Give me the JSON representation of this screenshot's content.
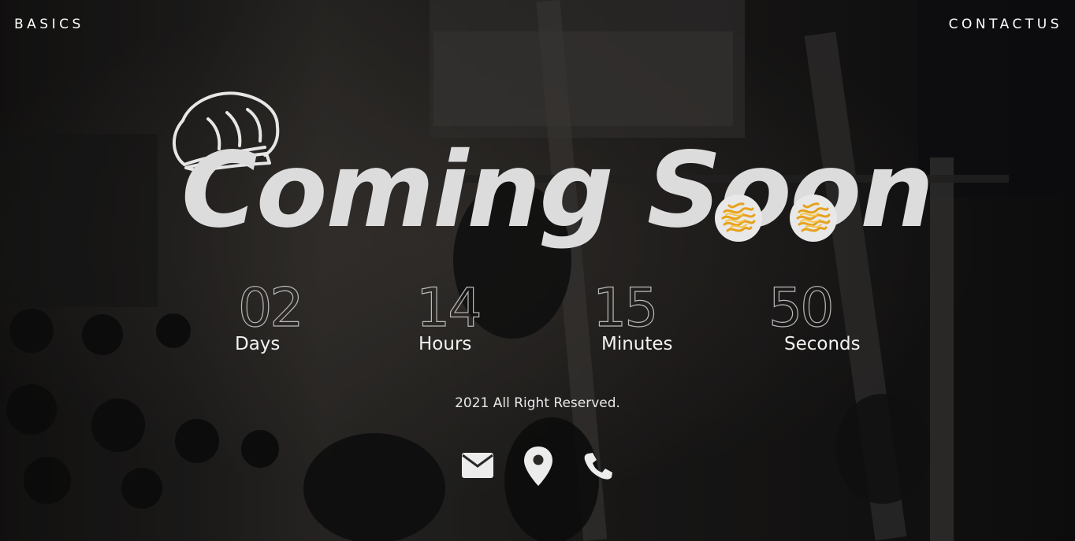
{
  "nav": {
    "left_label": "BASICS",
    "right_label": "CONTACTUS"
  },
  "hero": {
    "headline": "Coming Soon",
    "logo_icon": "chef-hat-icon",
    "decor_icons": [
      "pasta-icon",
      "pasta-icon"
    ]
  },
  "countdown": {
    "days": {
      "value": "02",
      "label": "Days"
    },
    "hours": {
      "value": "14",
      "label": "Hours"
    },
    "minutes": {
      "value": "15",
      "label": "Minutes"
    },
    "seconds": {
      "value": "50",
      "label": "Seconds"
    }
  },
  "footer": {
    "copyright": "2021 All Right Reserved.",
    "icons": [
      "mail-icon",
      "location-pin-icon",
      "phone-icon"
    ]
  },
  "colors": {
    "text": "#ffffff",
    "headline": "#dcdcdc",
    "counter_outline": "#b9b9b9",
    "pasta": "#f2b53a"
  }
}
